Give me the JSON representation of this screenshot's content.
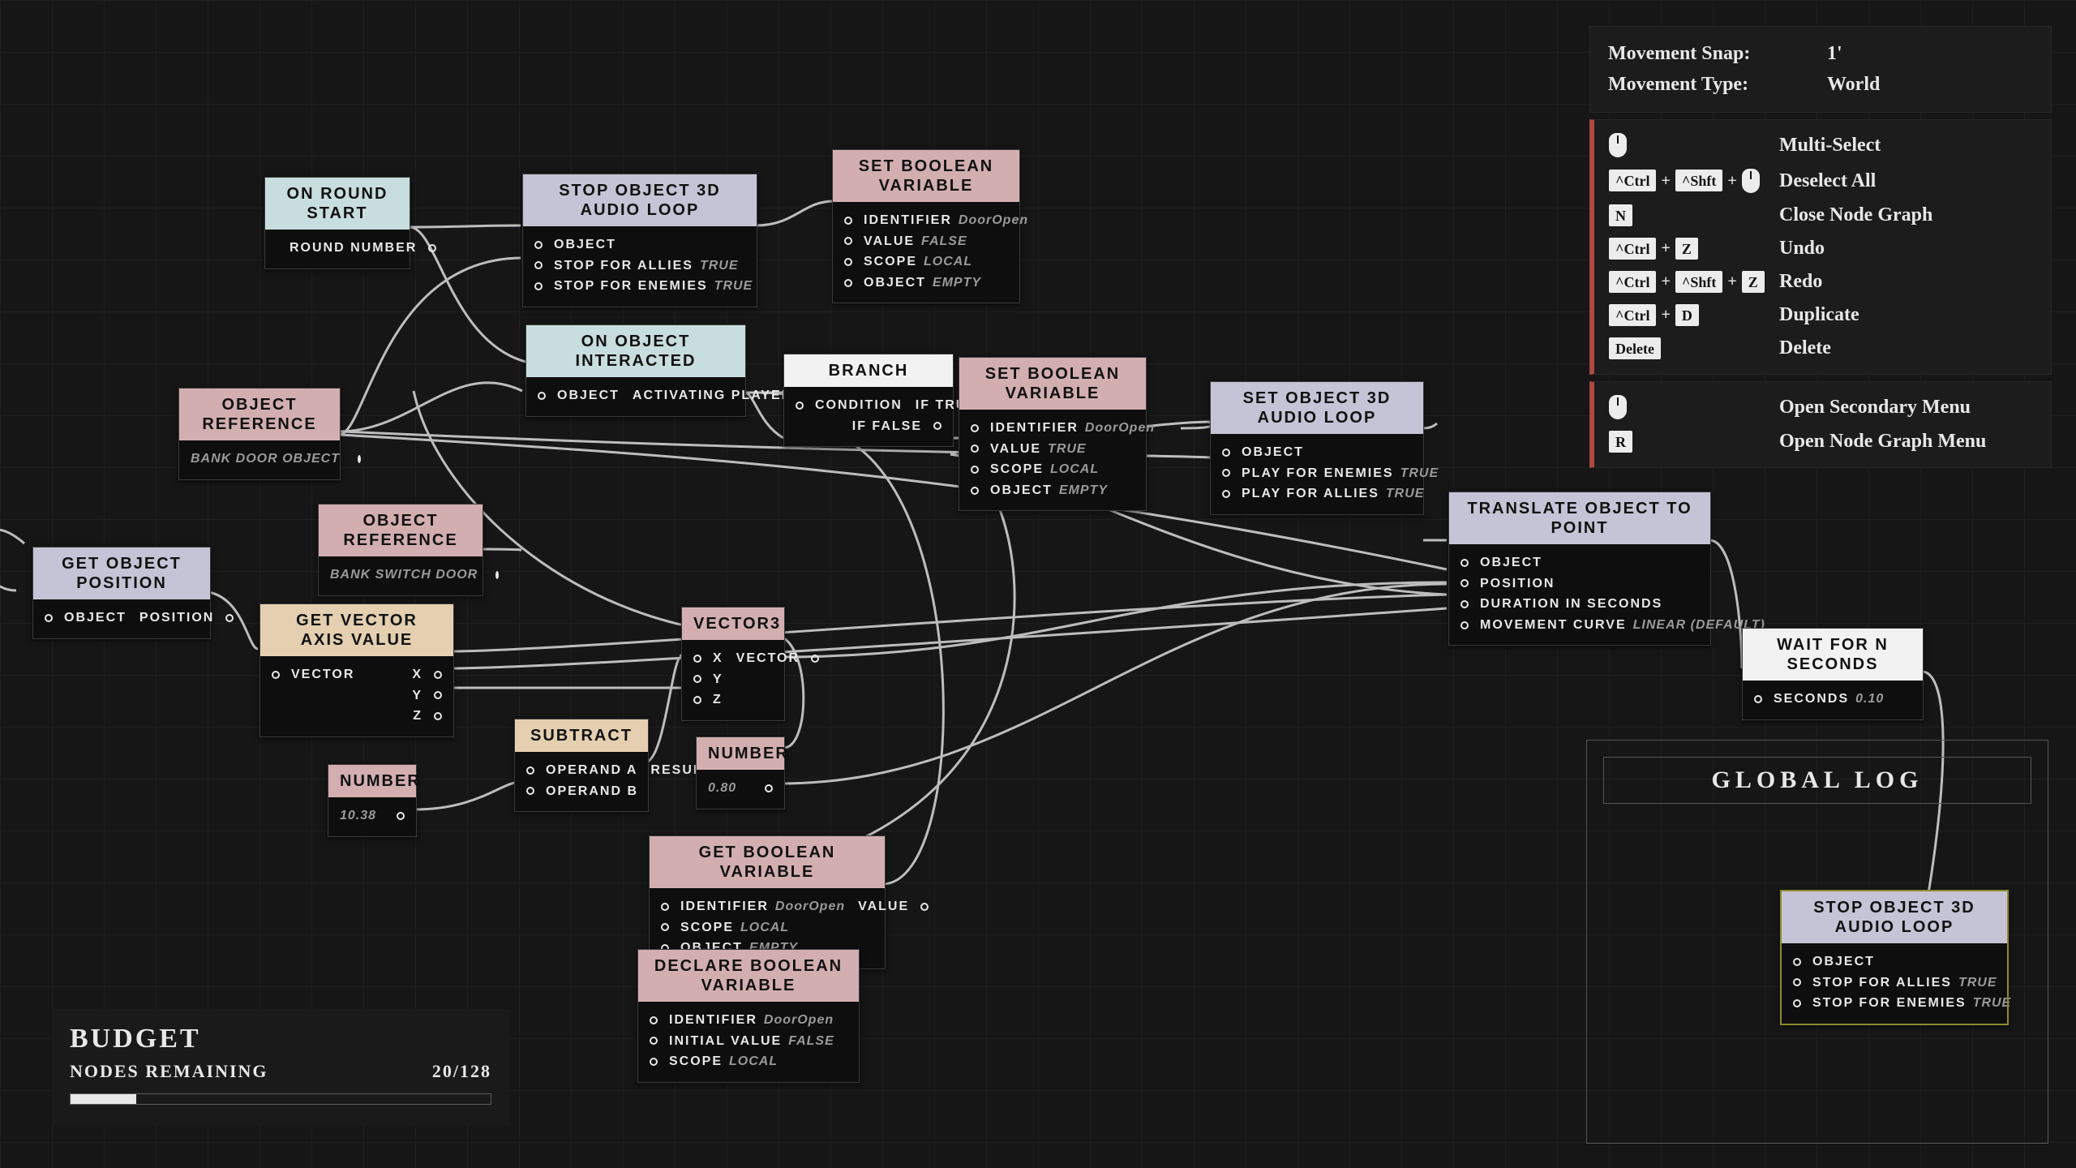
{
  "side_panel": {
    "movement_snap_label": "Movement Snap:",
    "movement_snap_value": "1'",
    "movement_type_label": "Movement Type:",
    "movement_type_value": "World",
    "hotkeys": [
      {
        "keys": [
          "mouse"
        ],
        "label": "Multi-Select"
      },
      {
        "keys": [
          "^Ctrl",
          "+",
          "^Shft",
          "+",
          "mouse"
        ],
        "label": "Deselect All"
      },
      {
        "keys": [
          "N"
        ],
        "label": "Close Node Graph"
      },
      {
        "keys": [
          "^Ctrl",
          "+",
          "Z"
        ],
        "label": "Undo"
      },
      {
        "keys": [
          "^Ctrl",
          "+",
          "^Shft",
          "+",
          "Z"
        ],
        "label": "Redo"
      },
      {
        "keys": [
          "^Ctrl",
          "+",
          "D"
        ],
        "label": "Duplicate"
      },
      {
        "keys": [
          "Delete"
        ],
        "label": "Delete"
      }
    ],
    "hotkeys2": [
      {
        "keys": [
          "mouse"
        ],
        "label": "Open Secondary Menu"
      },
      {
        "keys": [
          "R"
        ],
        "label": "Open Node Graph Menu"
      }
    ]
  },
  "budget": {
    "title": "BUDGET",
    "label": "NODES REMAINING",
    "value": "20/128",
    "fill_fraction": 0.156
  },
  "global_log": {
    "title": "GLOBAL LOG"
  },
  "nodes": {
    "on_round_start": {
      "title": "ON ROUND START",
      "out0": "ROUND NUMBER"
    },
    "stop_audio_1": {
      "title": "STOP OBJECT 3D AUDIO LOOP",
      "r0": "OBJECT",
      "r1l": "STOP FOR ALLIES",
      "r1v": "TRUE",
      "r2l": "STOP FOR ENEMIES",
      "r2v": "TRUE"
    },
    "set_bool_1": {
      "title": "SET BOOLEAN VARIABLE",
      "r0l": "IDENTIFIER",
      "r0v": "DoorOpen",
      "r1l": "VALUE",
      "r1v": "FALSE",
      "r2l": "SCOPE",
      "r2v": "LOCAL",
      "r3l": "OBJECT",
      "r3v": "EMPTY"
    },
    "objref_1": {
      "title": "OBJECT REFERENCE",
      "sub": "BANK DOOR OBJECT"
    },
    "objref_2": {
      "title": "OBJECT REFERENCE",
      "sub": "BANK SWITCH DOOR"
    },
    "on_interact": {
      "title": "ON OBJECT INTERACTED",
      "l": "OBJECT",
      "r": "ACTIVATING PLAYER"
    },
    "branch": {
      "title": "BRANCH",
      "l": "CONDITION",
      "r0": "IF TRUE",
      "r1": "IF FALSE"
    },
    "set_bool_2": {
      "title": "SET BOOLEAN VARIABLE",
      "r0l": "IDENTIFIER",
      "r0v": "DoorOpen",
      "r1l": "VALUE",
      "r1v": "TRUE",
      "r2l": "SCOPE",
      "r2v": "LOCAL",
      "r3l": "OBJECT",
      "r3v": "EMPTY"
    },
    "set_audio": {
      "title": "SET OBJECT 3D AUDIO LOOP",
      "r0": "OBJECT",
      "r1l": "PLAY FOR ENEMIES",
      "r1v": "TRUE",
      "r2l": "PLAY FOR ALLIES",
      "r2v": "TRUE"
    },
    "get_pos": {
      "title": "GET OBJECT POSITION",
      "l": "OBJECT",
      "r": "POSITION"
    },
    "get_vec_axis": {
      "title": "GET VECTOR AXIS VALUE",
      "l": "VECTOR",
      "r0": "X",
      "r1": "Y",
      "r2": "Z"
    },
    "vector3": {
      "title": "VECTOR3",
      "l0": "X",
      "l1": "Y",
      "l2": "Z",
      "r": "VECTOR"
    },
    "subtract": {
      "title": "SUBTRACT",
      "l0": "OPERAND A",
      "l1": "OPERAND B",
      "r": "RESULT"
    },
    "number_1": {
      "title": "NUMBER",
      "v": "10.38"
    },
    "number_2": {
      "title": "NUMBER",
      "v": "0.80"
    },
    "get_bool": {
      "title": "GET BOOLEAN VARIABLE",
      "r0l": "IDENTIFIER",
      "r0v": "DoorOpen",
      "out": "VALUE",
      "r1l": "SCOPE",
      "r1v": "LOCAL",
      "r2l": "OBJECT",
      "r2v": "EMPTY"
    },
    "declare_bool": {
      "title": "DECLARE BOOLEAN VARIABLE",
      "r0l": "IDENTIFIER",
      "r0v": "DoorOpen",
      "r1l": "INITIAL VALUE",
      "r1v": "FALSE",
      "r2l": "SCOPE",
      "r2v": "LOCAL"
    },
    "translate": {
      "title": "TRANSLATE OBJECT TO POINT",
      "r0": "OBJECT",
      "r1": "POSITION",
      "r2": "DURATION IN SECONDS",
      "r3l": "MOVEMENT CURVE",
      "r3v": "LINEAR (DEFAULT)"
    },
    "wait": {
      "title": "WAIT FOR N SECONDS",
      "l": "SECONDS",
      "v": "0.10"
    },
    "stop_audio_2": {
      "title": "STOP OBJECT 3D AUDIO LOOP",
      "r0": "OBJECT",
      "r1l": "STOP FOR ALLIES",
      "r1v": "TRUE",
      "r2l": "STOP FOR ENEMIES",
      "r2v": "TRUE"
    }
  }
}
